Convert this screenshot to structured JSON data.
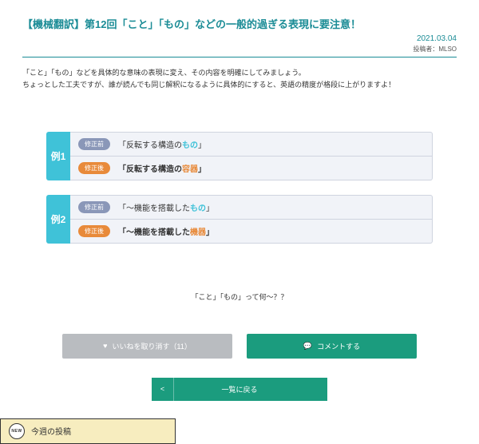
{
  "article": {
    "title": "【機械翻訳】第12回「こと」「もの」などの一般的過ぎる表現に要注意！",
    "date": "2021.03.04",
    "author_label": "投稿者：MLSO",
    "lead_line1": "「こと」「もの」などを具体的な意味の表現に変え、その内容を明確にしてみましょう。",
    "lead_line2": "ちょっとした工夫ですが、誰が読んでも同じ解釈になるように具体的にすると、英語の精度が格段に上がりますよ！",
    "footnote": "「こと」「もの」って何〜？？"
  },
  "labels": {
    "before": "修正前",
    "after": "修正後"
  },
  "examples": [
    {
      "num": "例1",
      "before_plain": "「反転する構造の",
      "before_hl": "もの",
      "before_tail": "」",
      "after_plain": "「反転する構造の",
      "after_hl": "容器",
      "after_tail": "」"
    },
    {
      "num": "例2",
      "before_plain": "「〜機能を搭載した",
      "before_hl": "もの",
      "before_tail": "」",
      "after_plain": "「〜機能を搭載した",
      "after_hl": "機器",
      "after_tail": "」"
    }
  ],
  "buttons": {
    "like": "いいねを取り消す（11）",
    "comment": "コメントする",
    "back": "一覧に戻る",
    "chevron": "<"
  },
  "weekly": {
    "badge": "NEW",
    "label": "今週の投稿"
  },
  "icons": {
    "heart": "♥",
    "bubble": "💬"
  }
}
